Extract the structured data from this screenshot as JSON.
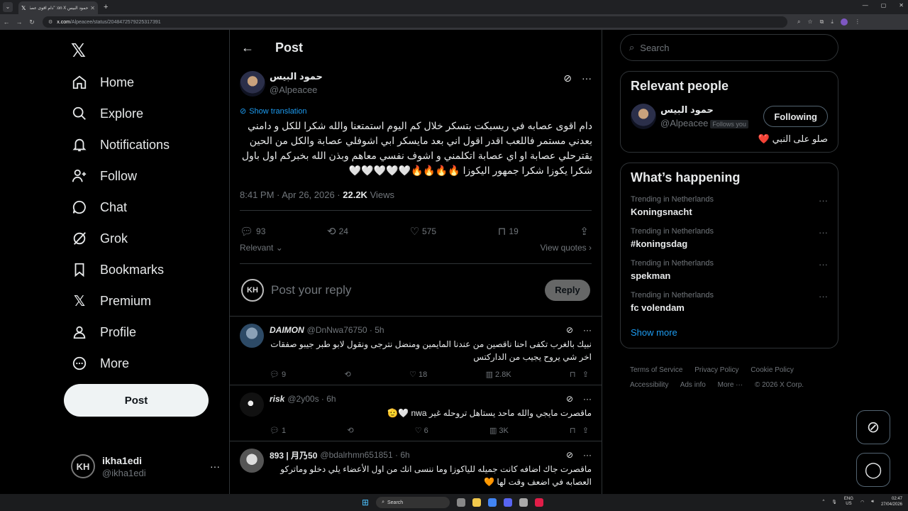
{
  "browser": {
    "tab_title": "حمود البيس on X: \"دام اقوى عصا...",
    "url_site": "x.com",
    "url_path": "/Alpeacee/status/2048472579225317391"
  },
  "nav": {
    "items": [
      {
        "label": "Home"
      },
      {
        "label": "Explore"
      },
      {
        "label": "Notifications"
      },
      {
        "label": "Follow"
      },
      {
        "label": "Chat"
      },
      {
        "label": "Grok"
      },
      {
        "label": "Bookmarks"
      },
      {
        "label": "Premium"
      },
      {
        "label": "Profile"
      },
      {
        "label": "More"
      }
    ],
    "post_button": "Post",
    "account_name": "ikha1edi",
    "account_handle": "@ikha1edi",
    "account_avatar": "KH"
  },
  "main": {
    "title": "Post",
    "tweet": {
      "author_name": "حمود البيس",
      "author_handle": "@Alpeacee",
      "show_translation": "Show translation",
      "text": "دام اقوى عصابه في ريسبكت بتسكر خلال كم اليوم استمتعنا والله شكرا للكل و دامني بعدني مستمر فاللعب اقدر اقول اني بعد مايسكر  ابي اشوفلي عصابة والكل من الحين يقترحلي عصابة او اي عصابة اتكلمني و اشوف نفسي معاهم وبذن الله بخبركم اول باول شكرا يكوزا شكرا جمهور اليكوزا 🔥🔥🔥🔥🤍🤍🤍🤍🤍",
      "time": "8:41 PM · Apr 26, 2026 · ",
      "views_count": "22.2K",
      "views_label": " Views",
      "replies": "93",
      "reposts": "24",
      "likes": "575",
      "bookmarks": "19",
      "relevant": "Relevant ⌄",
      "view_quotes": "View quotes ›"
    },
    "reply_box": {
      "placeholder": "Post your reply",
      "button": "Reply"
    },
    "replies": [
      {
        "name": "DAIMON",
        "handle": "@DnNwa76750 · 5h",
        "text": "نبيك بالغرب تكفى احنا ناقصين من عندنا المايمين ومنضل نترجى ونقول لابو طبر جيبو صفقات اخر شي يروح يجيب من الداركتس",
        "replies": "9",
        "reposts": "",
        "likes": "18",
        "views": "2.8K"
      },
      {
        "name": "risk",
        "handle": "@2y00s · 6h",
        "text": "ماقصرت مايجي والله ماحد يستاهل تروحله غير nwa 🤍🫡",
        "replies": "1",
        "reposts": "",
        "likes": "6",
        "views": "3K"
      },
      {
        "name": "893 | 月乃50",
        "handle": "@bdalrhmn651851 · 6h",
        "text": "ماقصرت جاك اضافه كانت جميله للياكوزا وما ننسى انك من اول الأعضاء يلي دخلو وماتركو العصابه في اضعف وقت لها 🧡",
        "replies": "",
        "reposts": "",
        "likes": "",
        "views": ""
      }
    ]
  },
  "sidebar": {
    "search_placeholder": "Search",
    "relevant_title": "Relevant people",
    "person_name": "حمود البيس",
    "person_handle": "@Alpeacee",
    "follows_you": "Follows you",
    "following_button": "Following",
    "bio": "صلو على النبي ❤️",
    "happening_title": "What’s happening",
    "trends": [
      {
        "category": "Trending in Netherlands",
        "topic": "Koningsnacht"
      },
      {
        "category": "Trending in Netherlands",
        "topic": "#koningsdag"
      },
      {
        "category": "Trending in Netherlands",
        "topic": "spekman"
      },
      {
        "category": "Trending in Netherlands",
        "topic": "fc volendam"
      }
    ],
    "show_more": "Show more",
    "footer": [
      "Terms of Service",
      "Privacy Policy",
      "Cookie Policy",
      "Accessibility",
      "Ads info",
      "More ···",
      "© 2026 X Corp."
    ]
  },
  "taskbar": {
    "search": "Search",
    "lang1": "ENG",
    "lang2": "US",
    "time": "02:47",
    "date": "27/04/2026"
  },
  "colors": {
    "accent": "#1d9bf0",
    "border": "#2f3336",
    "muted": "#71767b"
  }
}
